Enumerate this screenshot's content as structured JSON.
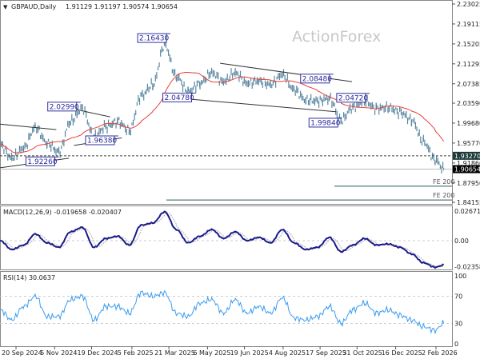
{
  "header": {
    "symbol": "GBPAUD,Daily",
    "ohlc": "1.91129 1.91197 1.90574 1.90654"
  },
  "watermark": "ActionForex",
  "colors": {
    "price": "#5b87a0",
    "ma": "#e8413c",
    "macd": "#1a1a8c",
    "macd_signal": "#b0b0b0",
    "rsi": "#3d9cf0",
    "annotation": "#3030a0",
    "current_price_bg": "#000000",
    "level_bg": "#1e3a3a"
  },
  "chart_data": [
    {
      "type": "line",
      "panel": "price",
      "y_ticks": [
        "2.23025",
        "2.19115",
        "2.15205",
        "2.11295",
        "2.07385",
        "2.03590",
        "1.99680",
        "1.95770",
        "1.91860",
        "1.87950",
        "1.84155"
      ],
      "ylim": [
        1.84155,
        2.23025
      ],
      "x_ticks": [
        "20 Sep 2024",
        "5 Nov 2024",
        "19 Dec 2024",
        "5 Feb 2025",
        "21 Mar 2025",
        "6 May 2025",
        "19 Jun 2025",
        "4 Aug 2025",
        "17 Sep 2025",
        "31 Oct 2025",
        "16 Dec 2025",
        "2 Feb 2026"
      ],
      "x_tick_dates": [
        "2024-09-20",
        "2024-11-05",
        "2024-12-19",
        "2025-02-05",
        "2025-03-21",
        "2025-05-06",
        "2025-06-19",
        "2025-08-04",
        "2025-09-17",
        "2025-10-31",
        "2025-12-16",
        "2026-02-02"
      ],
      "x": [
        "2024-09-01",
        "2024-09-15",
        "2024-09-29",
        "2024-10-13",
        "2024-10-27",
        "2024-11-10",
        "2024-11-24",
        "2024-12-08",
        "2024-12-22",
        "2025-01-05",
        "2025-01-19",
        "2025-02-02",
        "2025-02-16",
        "2025-03-02",
        "2025-03-16",
        "2025-03-30",
        "2025-04-13",
        "2025-04-27",
        "2025-05-11",
        "2025-05-25",
        "2025-06-08",
        "2025-06-22",
        "2025-07-06",
        "2025-07-20",
        "2025-08-03",
        "2025-08-17",
        "2025-08-31",
        "2025-09-14",
        "2025-09-28",
        "2025-10-12",
        "2025-10-26",
        "2025-11-09",
        "2025-11-23",
        "2025-12-07",
        "2025-12-21",
        "2026-01-04",
        "2026-01-18",
        "2026-02-01",
        "2026-02-11"
      ],
      "values": [
        1.955,
        1.928,
        1.948,
        1.988,
        1.958,
        1.94,
        2.0,
        2.025,
        1.97,
        1.99,
        2.0,
        1.982,
        2.05,
        2.072,
        2.15,
        2.088,
        2.058,
        2.075,
        2.095,
        2.078,
        2.095,
        2.075,
        2.08,
        2.072,
        2.092,
        2.062,
        2.042,
        2.04,
        2.045,
        2.003,
        2.028,
        2.04,
        2.025,
        2.028,
        2.018,
        2.003,
        1.96,
        1.925,
        1.9065
      ],
      "annotations": [
        {
          "label": "2.16430",
          "date": "2025-03-20",
          "price": 2.1643
        },
        {
          "label": "2.02990",
          "date": "2024-12-03",
          "price": 2.0299
        },
        {
          "label": "1.96380",
          "date": "2025-01-17",
          "price": 1.9638
        },
        {
          "label": "1.92260",
          "date": "2024-11-07",
          "price": 1.9226
        },
        {
          "label": "2.04780",
          "date": "2025-04-19",
          "price": 2.0478
        },
        {
          "label": "2.08480",
          "date": "2025-09-30",
          "price": 2.0848
        },
        {
          "label": "2.04720",
          "date": "2025-11-12",
          "price": 2.0472
        },
        {
          "label": "1.99840",
          "date": "2025-10-10",
          "price": 1.9984
        }
      ],
      "trendlines": [
        {
          "from": [
            "2024-08-31",
            1.995
          ],
          "to": [
            "2024-11-07",
            1.984
          ]
        },
        {
          "from": [
            "2024-08-31",
            1.909
          ],
          "to": [
            "2024-11-22",
            1.928
          ]
        },
        {
          "from": [
            "2024-11-12",
            2.03
          ],
          "to": [
            "2025-01-10",
            2.009
          ]
        },
        {
          "from": [
            "2024-11-28",
            1.953
          ],
          "to": [
            "2025-01-24",
            1.968
          ]
        },
        {
          "from": [
            "2025-04-13",
            2.044
          ],
          "to": [
            "2025-10-06",
            2.019
          ]
        },
        {
          "from": [
            "2025-05-21",
            2.114
          ],
          "to": [
            "2025-10-25",
            2.078
          ]
        }
      ],
      "levels": [
        {
          "label": "1.93270",
          "price": 1.9327,
          "style": "dashed"
        },
        {
          "label": "1.90654",
          "price": 1.90654,
          "style": "current"
        }
      ],
      "fe_lines": [
        {
          "label": "FE 200",
          "price": 1.873
        },
        {
          "label": "FE 200",
          "price": 1.846
        }
      ]
    },
    {
      "type": "line",
      "panel": "macd",
      "title": "MACD(12,26,9) -0.019658 -0.020407",
      "y_ticks": [
        "0.026715",
        "0.00",
        "-0.023588"
      ],
      "ylim": [
        -0.023588,
        0.026715
      ],
      "values": [
        0.0,
        -0.008,
        -0.004,
        0.006,
        -0.002,
        -0.006,
        0.008,
        0.012,
        -0.006,
        0.002,
        0.004,
        -0.004,
        0.014,
        0.016,
        0.026,
        0.01,
        -0.002,
        0.004,
        0.01,
        0.002,
        0.008,
        0.0,
        0.003,
        -0.002,
        0.01,
        -0.002,
        -0.008,
        -0.006,
        0.003,
        -0.01,
        -0.004,
        0.002,
        -0.004,
        -0.003,
        -0.006,
        -0.012,
        -0.02,
        -0.024,
        -0.022
      ]
    },
    {
      "type": "line",
      "panel": "rsi",
      "title": "RSI(14) 30.0637",
      "y_ticks": [
        "100",
        "70",
        "30",
        "0"
      ],
      "ylim": [
        0,
        100
      ],
      "values": [
        50,
        35,
        55,
        70,
        40,
        40,
        65,
        70,
        35,
        55,
        55,
        45,
        75,
        70,
        75,
        45,
        40,
        60,
        65,
        45,
        65,
        45,
        55,
        45,
        68,
        38,
        35,
        40,
        55,
        30,
        50,
        60,
        45,
        50,
        42,
        35,
        25,
        20,
        30
      ]
    }
  ]
}
